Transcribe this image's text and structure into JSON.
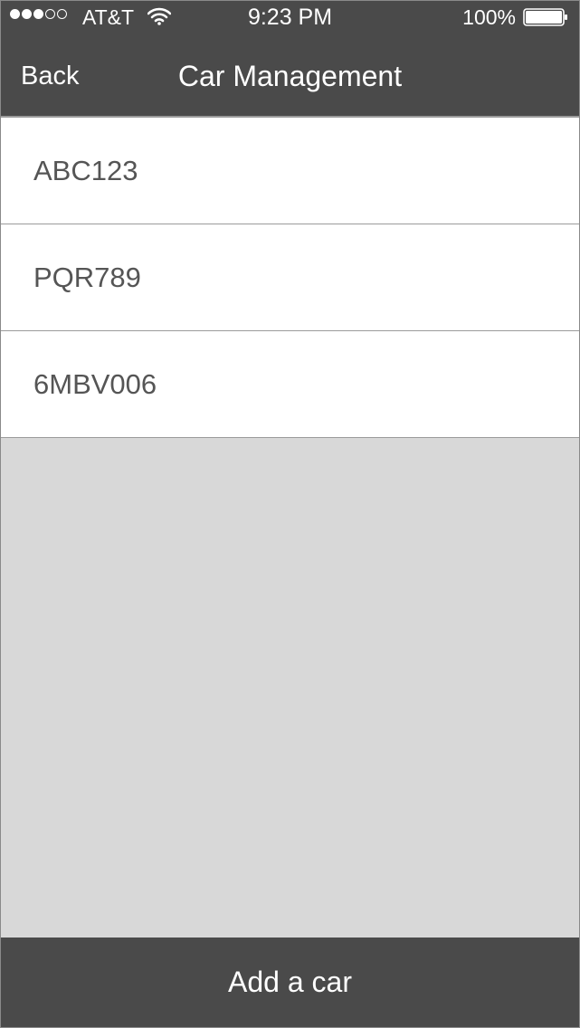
{
  "status_bar": {
    "signal_dots_filled": 3,
    "signal_dots_total": 5,
    "carrier": "AT&T",
    "wifi_icon": "wifi-icon",
    "time": "9:23 PM",
    "battery_percent_text": "100%",
    "battery_level": 1.0
  },
  "nav": {
    "back_label": "Back",
    "title": "Car Management"
  },
  "cars": [
    {
      "plate": "ABC123"
    },
    {
      "plate": "PQR789"
    },
    {
      "plate": "6MBV006"
    }
  ],
  "footer": {
    "add_button_label": "Add a car"
  },
  "colors": {
    "bar_background": "#4a4a4a",
    "list_background": "#ffffff",
    "empty_area_background": "#d8d8d8",
    "item_text": "#555555",
    "bar_text": "#ffffff"
  }
}
